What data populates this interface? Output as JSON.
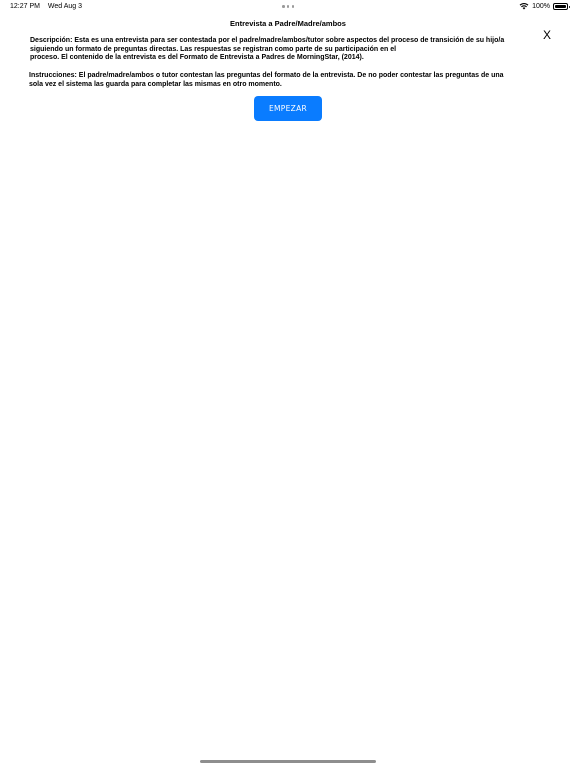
{
  "status_bar": {
    "time": "12:27 PM",
    "day": "Wed Aug 3",
    "battery": "100%",
    "battery_level": 1.0
  },
  "header": {
    "title": "Entrevista a Padre/Madre/ambos",
    "close_label": "X"
  },
  "content": {
    "description": "Descripción: Esta es una entrevista para ser contestada por el padre/madre/ambos/tutor sobre aspectos del proceso de transición de su hijo/a\nsiguiendo un formato de preguntas directas. Las respuestas  se registran como parte de su participación en el\nproceso. El contenido de la entrevista es del Formato de Entrevista a Padres de MorningStar, (2014).",
    "instructions": "Instrucciones: El padre/madre/ambos o tutor contestan las preguntas del formato de la entrevista. De no poder contestar las preguntas de una\nsola vez el sistema las guarda para completar las mismas en otro momento."
  },
  "actions": {
    "start_label": "EMPEZAR",
    "start_color": "#0a7cff"
  },
  "icons": {
    "wifi": "wifi-icon",
    "battery": "battery-icon",
    "multitask": "multitasking-dots-icon"
  }
}
